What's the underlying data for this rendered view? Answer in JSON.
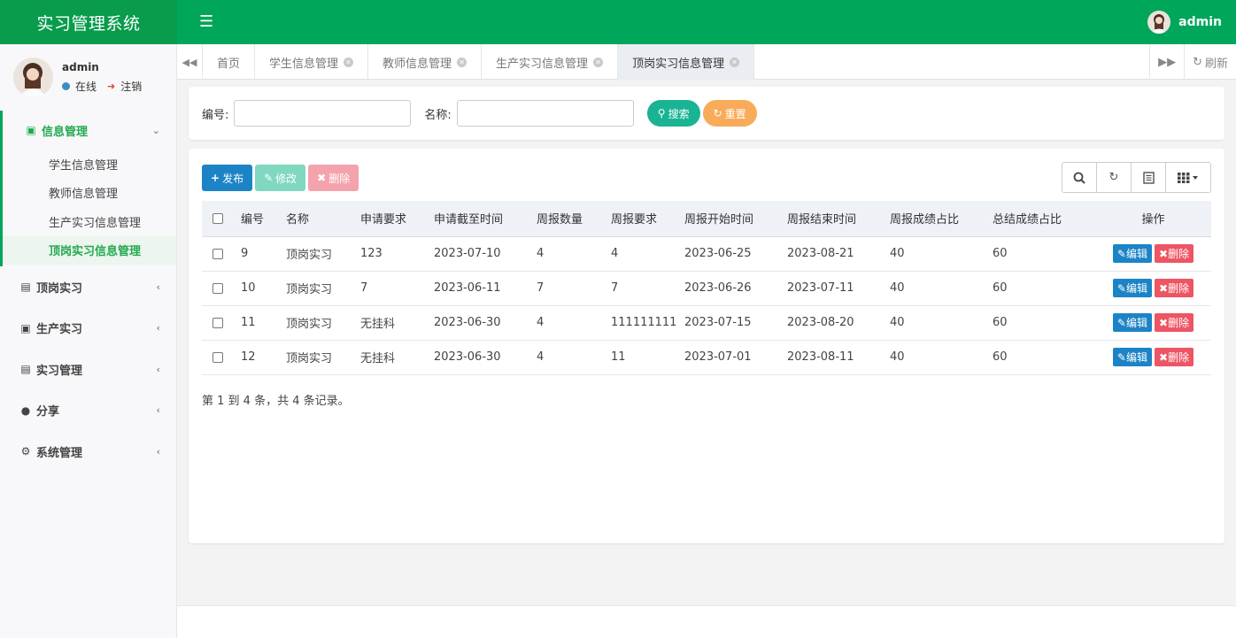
{
  "app": {
    "title": "实习管理系统"
  },
  "header": {
    "menu_icon": "bars-icon",
    "user_name": "admin"
  },
  "sidebar": {
    "user": {
      "name": "admin",
      "status": "在线",
      "logout": "注销"
    },
    "groups": [
      {
        "label": "信息管理",
        "icon": "address-book-icon",
        "active": true,
        "items": [
          {
            "label": "学生信息管理"
          },
          {
            "label": "教师信息管理"
          },
          {
            "label": "生产实习信息管理"
          },
          {
            "label": "顶岗实习信息管理",
            "current": true
          }
        ]
      },
      {
        "label": "顶岗实习",
        "icon": "id-card-icon"
      },
      {
        "label": "生产实习",
        "icon": "id-badge-icon"
      },
      {
        "label": "实习管理",
        "icon": "id-card-icon"
      },
      {
        "label": "分享",
        "icon": "comment-icon"
      },
      {
        "label": "系统管理",
        "icon": "cog-icon"
      }
    ]
  },
  "tabs": {
    "items": [
      {
        "label": "首页",
        "closable": false
      },
      {
        "label": "学生信息管理",
        "closable": true
      },
      {
        "label": "教师信息管理",
        "closable": true
      },
      {
        "label": "生产实习信息管理",
        "closable": true
      },
      {
        "label": "顶岗实习信息管理",
        "closable": true,
        "active": true
      }
    ],
    "refresh": "刷新"
  },
  "search": {
    "number_label": "编号:",
    "number_value": "",
    "name_label": "名称:",
    "name_value": "",
    "search_button": "搜索",
    "reset_button": "重置"
  },
  "toolbar": {
    "add": "发布",
    "edit": "修改",
    "delete": "删除"
  },
  "table": {
    "columns": [
      "编号",
      "名称",
      "申请要求",
      "申请截至时间",
      "周报数量",
      "周报要求",
      "周报开始时间",
      "周报结束时间",
      "周报成绩占比",
      "总结成绩占比",
      "操作"
    ],
    "rows": [
      [
        "9",
        "顶岗实习",
        "123",
        "2023-07-10",
        "4",
        "4",
        "2023-06-25",
        "2023-08-21",
        "40",
        "60"
      ],
      [
        "10",
        "顶岗实习",
        "7",
        "2023-06-11",
        "7",
        "7",
        "2023-06-26",
        "2023-07-11",
        "40",
        "60"
      ],
      [
        "11",
        "顶岗实习",
        "无挂科",
        "2023-06-30",
        "4",
        "111111111",
        "2023-07-15",
        "2023-08-20",
        "40",
        "60"
      ],
      [
        "12",
        "顶岗实习",
        "无挂科",
        "2023-06-30",
        "4",
        "11",
        "2023-07-01",
        "2023-08-11",
        "40",
        "60"
      ]
    ],
    "row_edit": "编辑",
    "row_delete": "删除",
    "summary": "第 1 到 4 条，共 4 条记录。"
  },
  "colors": {
    "brand": "#089c4c",
    "topbar": "#00a65a",
    "primary": "#1c84c6",
    "success": "#1ab394",
    "warning": "#f8ac59",
    "danger": "#ed5565"
  }
}
